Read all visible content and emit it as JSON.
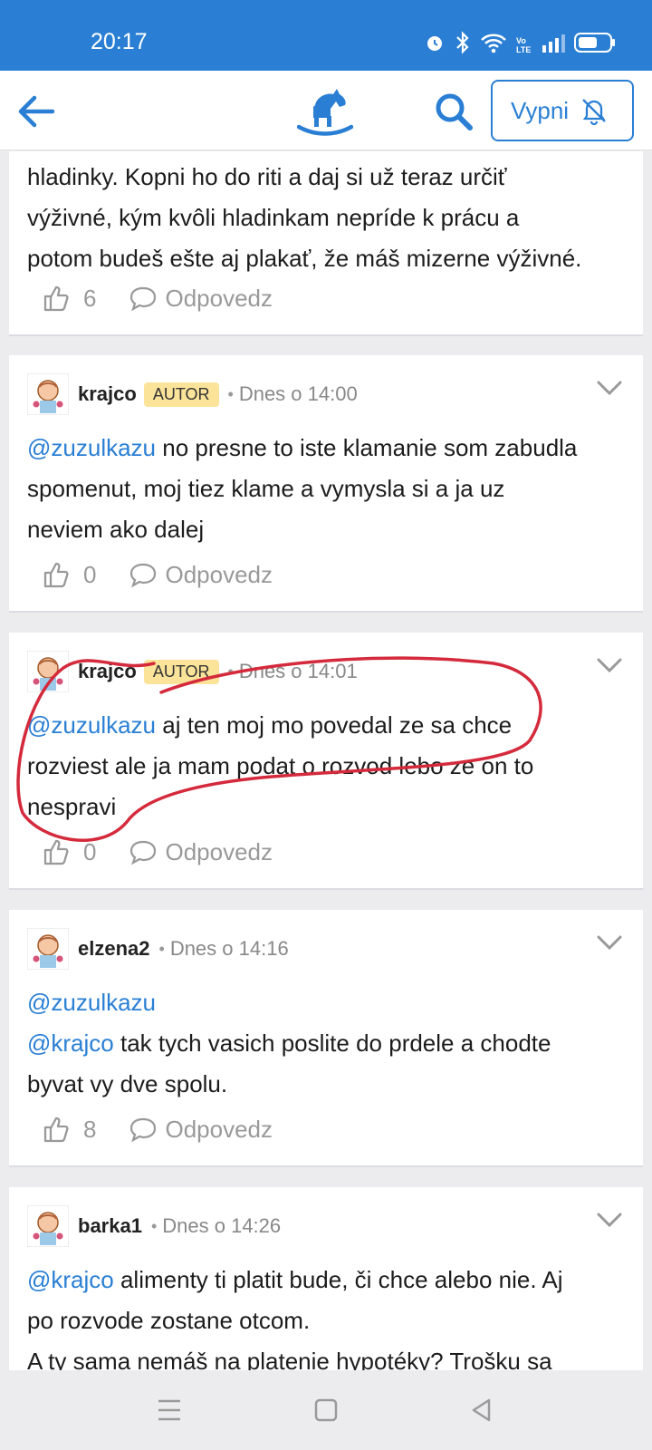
{
  "status": {
    "time": "20:17",
    "network": "Vo LTE"
  },
  "header": {
    "mute_label": "Vypni"
  },
  "comments": [
    {
      "body_lines": [
        "hladinky. Kopni ho do riti a daj si už teraz určiť",
        "výživné, kým kvôli hladinkam nepríde k prácu a",
        "potom budeš ešte aj plakať, že máš mizerne výživné."
      ],
      "likes": "6",
      "reply_label": "Odpovedz"
    },
    {
      "author": "krajco",
      "badge": "AUTOR",
      "time": "Dnes o 14:00",
      "mention": "@zuzulkazu",
      "text_first": " no presne to iste klamanie som zabudla",
      "text_rest": [
        "spomenut, moj tiez klame a vymysla si a ja uz",
        "neviem ako dalej"
      ],
      "likes": "0",
      "reply_label": "Odpovedz"
    },
    {
      "author": "krajco",
      "badge": "AUTOR",
      "time": "Dnes o 14:01",
      "mention": "@zuzulkazu",
      "text_first": " aj ten moj mo povedal ze sa chce",
      "text_rest": [
        "rozviest ale ja mam podat o rozvod lebo ze on to",
        "nespravi"
      ],
      "likes": "0",
      "reply_label": "Odpovedz"
    },
    {
      "author": "elzena2",
      "time": "Dnes o 14:16",
      "mention_line": "@zuzulkazu",
      "mention": "@krajco",
      "text_first": " tak tych vasich poslite do prdele a chodte",
      "text_rest": [
        "byvat vy dve spolu."
      ],
      "likes": "8",
      "reply_label": "Odpovedz"
    },
    {
      "author": "barka1",
      "time": "Dnes o 14:26",
      "mention": "@krajco",
      "text_first": " alimenty ti platit bude, či chce alebo nie. Aj",
      "text_rest": [
        "po rozvode zostane otcom.",
        "A ty sama nemáš na platenie hypotéky? Trošku sa"
      ]
    }
  ],
  "colors": {
    "primary": "#2a7fd4",
    "badge": "#fbe49a",
    "scribble": "#d42a3c"
  }
}
